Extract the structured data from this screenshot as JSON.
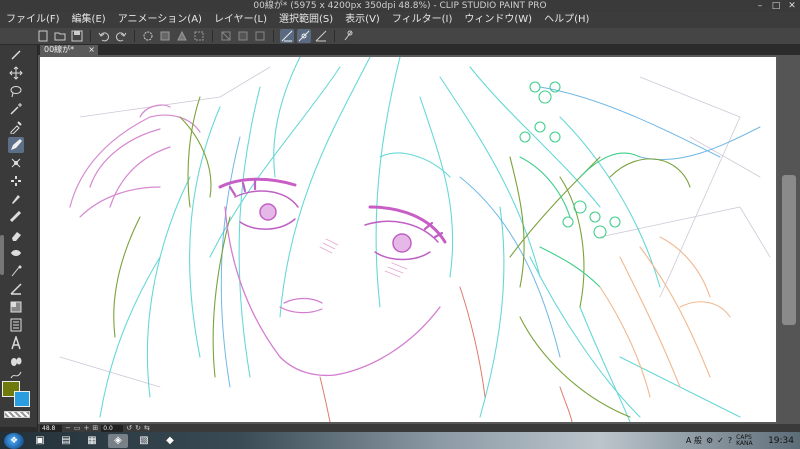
{
  "window": {
    "title": "00線が* (5975 x 4200px 350dpi 48.8%) - CLIP STUDIO PAINT PRO",
    "controls": [
      "–",
      "□",
      "✕"
    ]
  },
  "menu": [
    "ファイル(F)",
    "編集(E)",
    "アニメーション(A)",
    "レイヤー(L)",
    "選択範囲(S)",
    "表示(V)",
    "フィルター(I)",
    "ウィンドウ(W)",
    "ヘルプ(H)"
  ],
  "document_tab": {
    "label": "00線が*",
    "close": "×"
  },
  "statusbar": {
    "zoom": "48.8",
    "angle": "0.0"
  },
  "taskbar": {
    "tray_ime": "A 般",
    "tray_lang": "CAPS KANA",
    "clock": "19:34"
  },
  "colors": {
    "main": "#6f7a0a",
    "sub": "#2a9de0",
    "canvas": "#ffffff",
    "ui_dark": "#3a3a3a"
  }
}
